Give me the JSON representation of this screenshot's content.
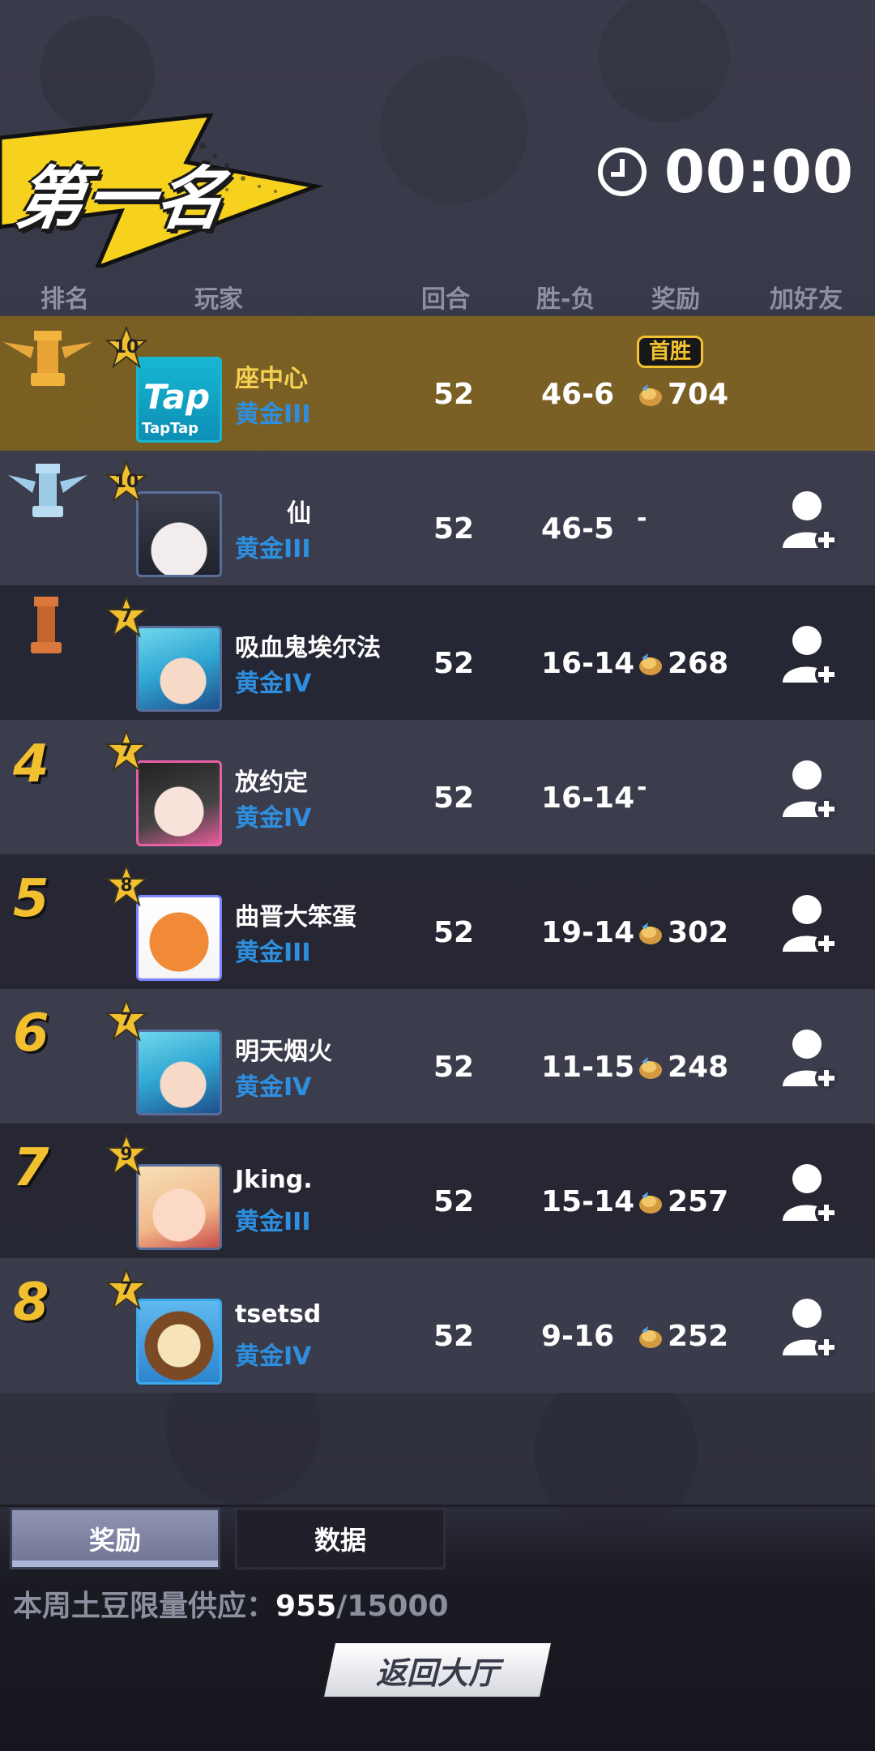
{
  "banner": {
    "title": "第一名"
  },
  "timer": {
    "value": "00:00"
  },
  "headers": {
    "rank": "排名",
    "player": "玩家",
    "rounds": "回合",
    "winloss": "胜-负",
    "reward": "奖励",
    "add_friend": "加好友"
  },
  "rows": [
    {
      "rank_icon": "gold-rook-icon",
      "level": "10",
      "avatar": "taptap-avatar",
      "name": "座中心",
      "tier": "黄金III",
      "rounds": "52",
      "winloss": "46-6",
      "reward": "704",
      "badge": "首胜",
      "add_friend": false
    },
    {
      "rank_icon": "silver-rook-icon",
      "level": "10",
      "avatar": "white-hair-girl-avatar",
      "name": "仙",
      "tier": "黄金III",
      "rounds": "52",
      "winloss": "46-5",
      "reward": "-",
      "add_friend": true
    },
    {
      "rank_icon": "bronze-rook-icon",
      "level": "7",
      "avatar": "cyan-hair-girl-avatar",
      "name": "吸血鬼埃尔法",
      "tier": "黄金IV",
      "rounds": "52",
      "winloss": "16-14",
      "reward": "268",
      "add_friend": true
    },
    {
      "rank": "4",
      "level": "7",
      "avatar": "black-hair-girl-avatar",
      "name": "放约定",
      "tier": "黄金IV",
      "rounds": "52",
      "winloss": "16-14",
      "reward": "-",
      "add_friend": true
    },
    {
      "rank": "5",
      "level": "8",
      "avatar": "tiger-avatar",
      "name": "曲晋大笨蛋",
      "tier": "黄金III",
      "rounds": "52",
      "winloss": "19-14",
      "reward": "302",
      "add_friend": true
    },
    {
      "rank": "6",
      "level": "7",
      "avatar": "cyan-hair-girl-avatar",
      "name": "明天烟火",
      "tier": "黄金IV",
      "rounds": "52",
      "winloss": "11-15",
      "reward": "248",
      "add_friend": true
    },
    {
      "rank": "7",
      "level": "9",
      "avatar": "blonde-girl-avatar",
      "name": "Jking.",
      "tier": "黄金III",
      "rounds": "52",
      "winloss": "15-14",
      "reward": "257",
      "add_friend": true
    },
    {
      "rank": "8",
      "level": "7",
      "avatar": "lion-avatar",
      "name": "tsetsd",
      "tier": "黄金IV",
      "rounds": "52",
      "winloss": "9-16",
      "reward": "252",
      "add_friend": true
    }
  ],
  "tabs": {
    "reward": "奖励",
    "data": "数据"
  },
  "supply": {
    "label": "本周土豆限量供应：",
    "current": "955",
    "total": "/15000"
  },
  "return_button": "返回大厅",
  "colors": {
    "gold_row": "#7a5f23",
    "accent_yellow": "#f2c02f",
    "tier_blue": "#2e8fe0"
  }
}
